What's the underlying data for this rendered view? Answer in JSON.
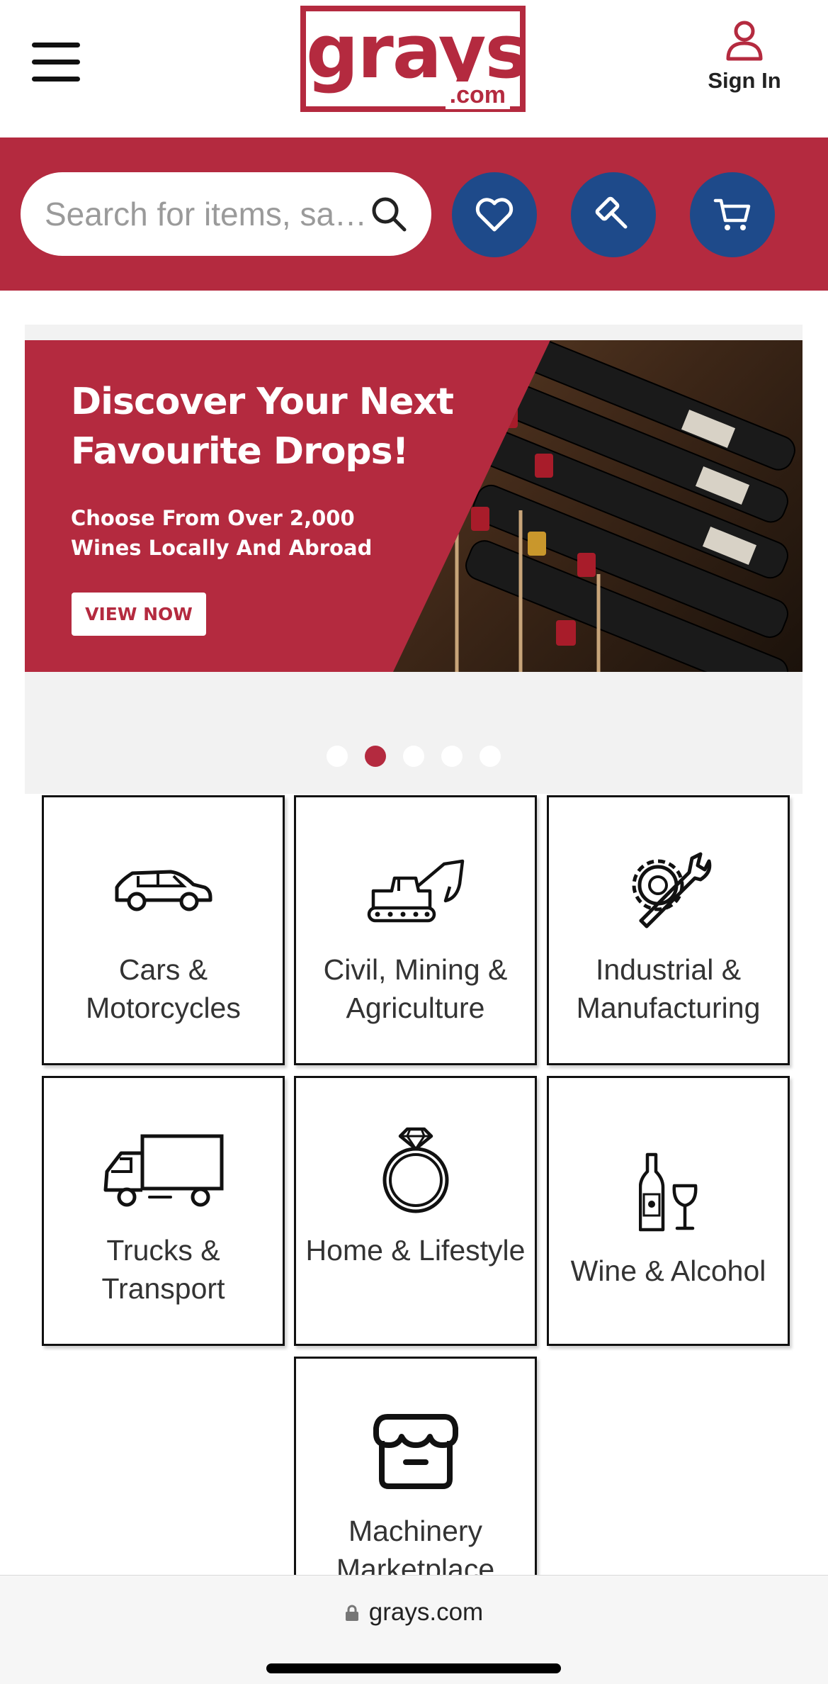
{
  "header": {
    "logo_text": "grays",
    "logo_domain": ".com",
    "signin_label": "Sign In"
  },
  "search": {
    "placeholder": "Search for items, sa…"
  },
  "actions": [
    "heart-icon",
    "gavel-icon",
    "cart-icon"
  ],
  "banner": {
    "headline": "Discover Your Next Favourite Drops!",
    "subtext": "Choose From Over 2,000 Wines Locally And Abroad",
    "button": "VIEW NOW",
    "slide_count": 5,
    "active_slide": 2
  },
  "categories": [
    {
      "label": "Cars & Motorcycles",
      "icon": "car-icon"
    },
    {
      "label": "Civil, Mining & Agriculture",
      "icon": "excavator-icon"
    },
    {
      "label": "Industrial & Manufacturing",
      "icon": "gear-wrench-icon"
    },
    {
      "label": "Trucks & Transport",
      "icon": "truck-icon"
    },
    {
      "label": "Home & Lifestyle",
      "icon": "ring-icon"
    },
    {
      "label": "Wine & Alcohol",
      "icon": "wine-icon"
    },
    {
      "label": "Machinery Marketplace",
      "icon": "store-icon"
    }
  ],
  "browser": {
    "url": "grays.com"
  },
  "colors": {
    "brand_red": "#b42a3f",
    "action_blue": "#1e4a8a"
  }
}
